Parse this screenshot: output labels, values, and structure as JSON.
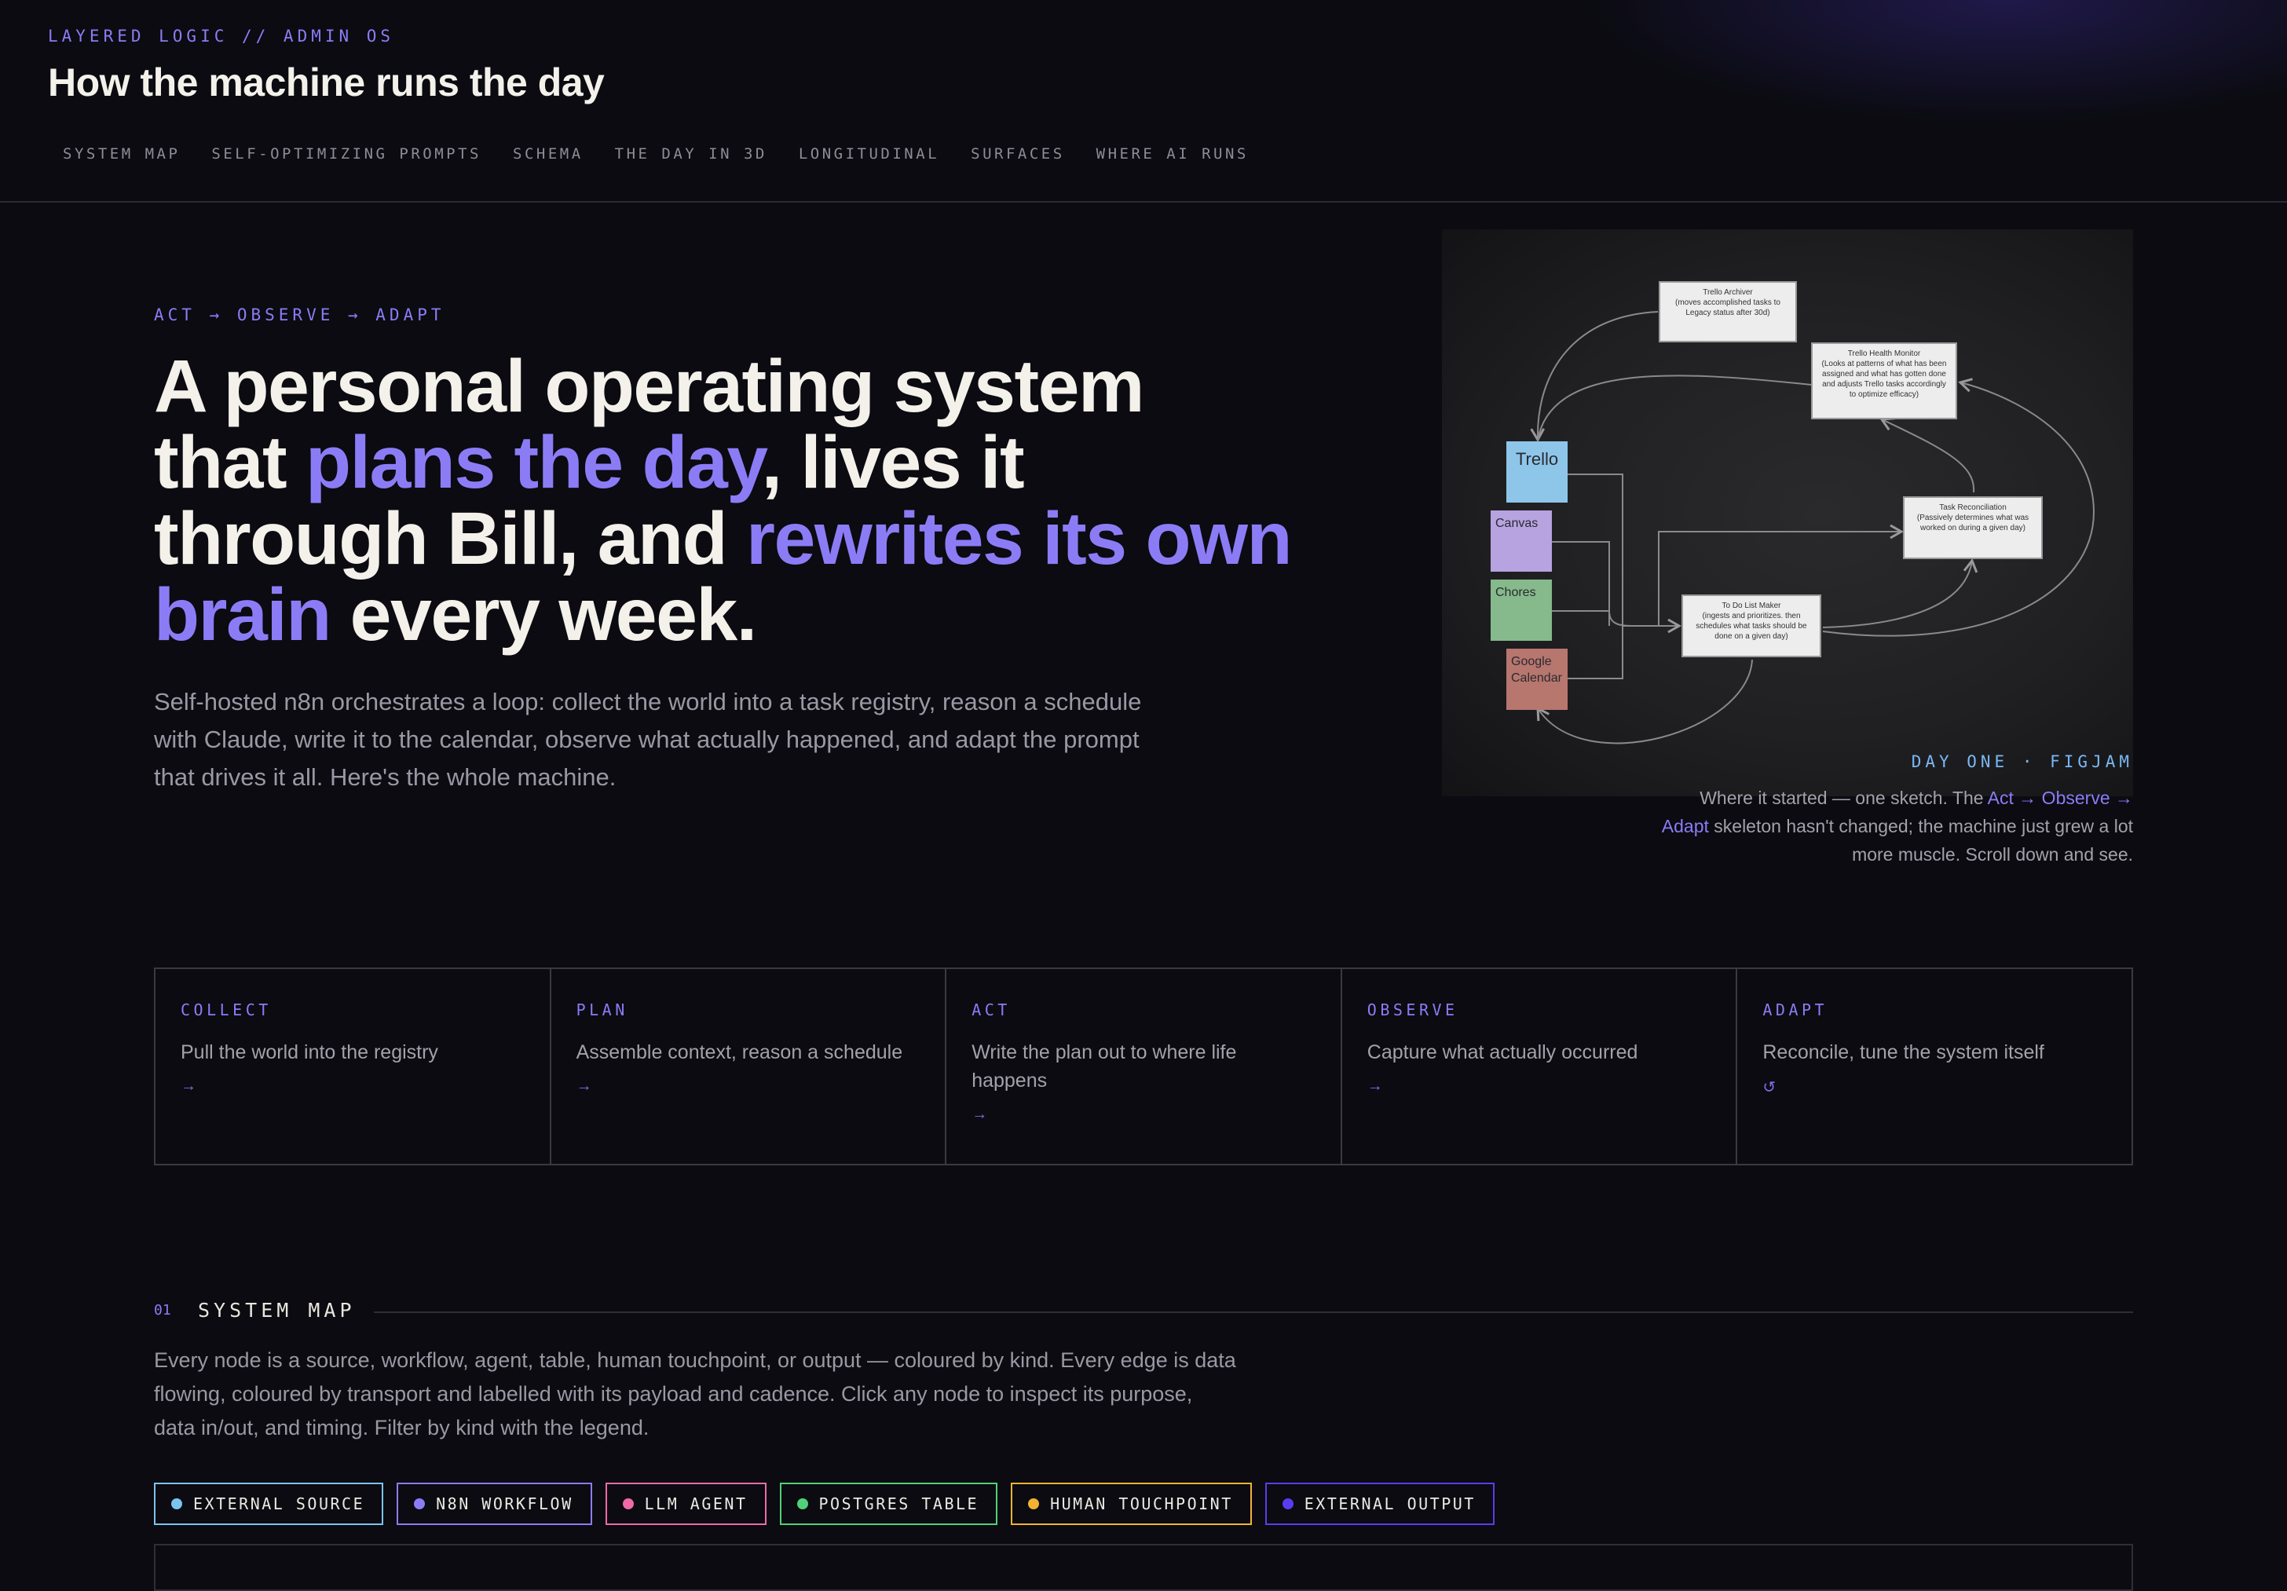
{
  "header": {
    "eyebrow": "LAYERED LOGIC // ADMIN OS",
    "title": "How the machine runs the day",
    "nav": [
      "SYSTEM MAP",
      "SELF-OPTIMIZING PROMPTS",
      "SCHEMA",
      "THE DAY IN 3D",
      "LONGITUDINAL",
      "SURFACES",
      "WHERE AI RUNS"
    ]
  },
  "hero": {
    "kicker": "ACT → OBSERVE → ADAPT",
    "headline": {
      "p1": "A personal operating system that ",
      "a1": "plans the day",
      "p2": ", lives it through Bill, and ",
      "a2": "rewrites its own brain",
      "p3": " every week."
    },
    "lede": "Self-hosted n8n orchestrates a loop: collect the world into a task registry, reason a schedule with Claude, write it to the calendar, observe what actually happened, and adapt the prompt that drives it all. Here's the whole machine."
  },
  "sketch": {
    "stickies": {
      "trello": "Trello",
      "canvas": "Canvas",
      "chores": "Chores",
      "gcal": "Google Calendar"
    },
    "notes": {
      "archiver_title": "Trello Archiver",
      "archiver_body": "(moves accomplished tasks to Legacy status after 30d)",
      "health_title": "Trello Health Monitor",
      "health_body": "(Looks at patterns of what has been assigned and what has gotten done and adjusts Trello tasks accordingly to optimize efficacy)",
      "recon_title": "Task Reconciliation",
      "recon_body": "(Passively determines what was worked on during a given day)",
      "todo_title": "To Do List Maker",
      "todo_body": "(ingests and prioritizes. then schedules what tasks should be done on a given day)"
    },
    "caption": "DAY ONE · FIGJAM",
    "desc": {
      "p1": "Where it started — one sketch. The ",
      "accent": "Act → Observe → Adapt",
      "p2": " skeleton hasn't changed; the machine just grew a lot more muscle. Scroll down and see."
    }
  },
  "phases": [
    {
      "label": "COLLECT",
      "desc": "Pull the world into the registry",
      "arrow": "→"
    },
    {
      "label": "PLAN",
      "desc": "Assemble context, reason a schedule",
      "arrow": "→"
    },
    {
      "label": "ACT",
      "desc": "Write the plan out to where life happens",
      "arrow": "→"
    },
    {
      "label": "OBSERVE",
      "desc": "Capture what actually occurred",
      "arrow": "→"
    },
    {
      "label": "ADAPT",
      "desc": "Reconcile, tune the system itself",
      "arrow": "↺"
    }
  ],
  "system_map": {
    "number": "01",
    "title": "SYSTEM MAP",
    "desc": "Every node is a source, workflow, agent, table, human touchpoint, or output — coloured by kind. Every edge is data flowing, coloured by transport and labelled with its payload and cadence. Click any node to inspect its purpose, data in/out, and timing. Filter by kind with the legend.",
    "legend": [
      {
        "label": "EXTERNAL SOURCE",
        "color": "#7cc4f0"
      },
      {
        "label": "N8N WORKFLOW",
        "color": "#8b7cf6"
      },
      {
        "label": "LLM AGENT",
        "color": "#f06aa8"
      },
      {
        "label": "POSTGRES TABLE",
        "color": "#4fd17a"
      },
      {
        "label": "HUMAN TOUCHPOINT",
        "color": "#f2b332"
      },
      {
        "label": "EXTERNAL OUTPUT",
        "color": "#5a3cf0"
      }
    ]
  },
  "colors": {
    "background": "#0b0b11",
    "accent": "#8b7cf6",
    "caption_blue": "#7ab8f5",
    "sticky_trello": "#8ec6ea",
    "sticky_canvas": "#b6a3e0",
    "sticky_chores": "#86b98c",
    "sticky_gcal": "#b7766e"
  }
}
